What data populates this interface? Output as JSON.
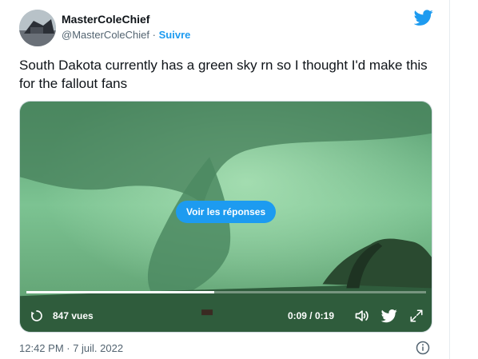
{
  "author": {
    "name": "MasterColeChief",
    "handle": "@MasterColeChief",
    "separator": "·",
    "follow_label": "Suivre"
  },
  "tweet": {
    "text": "South Dakota currently has a green sky rn so I thought I'd make this for the fallout fans"
  },
  "video": {
    "replies_button": "Voir les réponses",
    "views": "847 vues",
    "time": "0:09 / 0:19",
    "progress": 0.47
  },
  "footer": {
    "timestamp": "12:42 PM · 7 juil. 2022"
  },
  "icons": {
    "brand": "twitter-bird-icon",
    "views": "replay-icon",
    "volume": "volume-icon",
    "share": "twitter-bird-icon",
    "fullscreen": "expand-icon",
    "info": "info-icon"
  },
  "colors": {
    "accent": "#1d9bf0",
    "sky_green": "#6fbf84",
    "text_secondary": "#536471"
  }
}
